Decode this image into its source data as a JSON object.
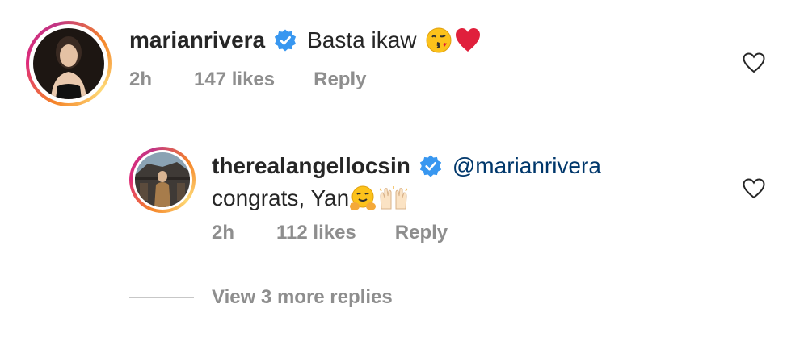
{
  "comments": [
    {
      "username": "marianrivera",
      "verified": true,
      "text": "Basta ikaw",
      "emojis": [
        "kissing-face-emoji",
        "red-heart-emoji"
      ],
      "time": "2h",
      "likes": "147 likes",
      "reply_label": "Reply"
    },
    {
      "username": "therealangellocsin",
      "verified": true,
      "mention": "@marianrivera",
      "text": "congrats, Yan",
      "emojis": [
        "hugging-face-emoji",
        "raising-hands-emoji"
      ],
      "time": "2h",
      "likes": "112 likes",
      "reply_label": "Reply"
    }
  ],
  "view_more_replies": "View 3 more replies",
  "colors": {
    "text": "#262626",
    "meta": "#8e8e8e",
    "mention": "#00376b",
    "verified": "#3897f0"
  },
  "icons": [
    "verified-badge-icon",
    "heart-outline-icon"
  ]
}
